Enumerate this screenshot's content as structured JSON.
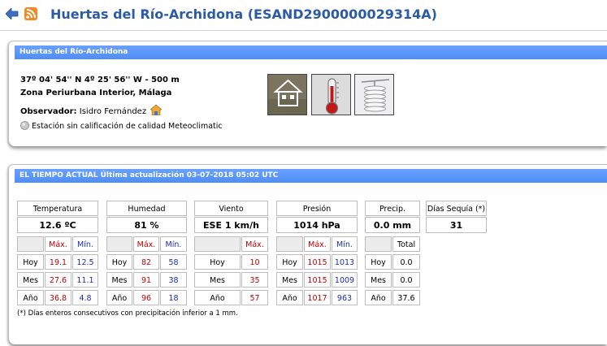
{
  "header": {
    "title": "Huertas del Río-Archidona (ESAND2900000029314A)",
    "back_icon": "back-arrow-icon",
    "rss_icon": "rss-feed-icon"
  },
  "station": {
    "panel_title": "Huertas del Río-Archidona",
    "coords": "37º 04' 54'' N   4º 25' 56'' W  -  500 m",
    "zone": "Zona Periurbana Interior, Málaga",
    "observer_label": "Observador:",
    "observer_name": "Isidro Fernández",
    "quality": "Estación sin calificación de calidad Meteoclimatic"
  },
  "weather": {
    "panel_title": "EL TIEMPO ACTUAL Última actualización 03-07-2018 05:02 UTC",
    "rows": [
      "Hoy",
      "Mes",
      "Año"
    ],
    "max_label": "Máx.",
    "min_label": "Mín.",
    "total_label": "Total",
    "temperature": {
      "label": "Temperatura",
      "current": "12.6 ºC",
      "max": [
        "19.1",
        "27.6",
        "36.8"
      ],
      "min": [
        "12.5",
        "11.1",
        "4.8"
      ]
    },
    "humidity": {
      "label": "Humedad",
      "current": "81 %",
      "max": [
        "82",
        "91",
        "96"
      ],
      "min": [
        "58",
        "38",
        "18"
      ]
    },
    "wind": {
      "label": "Viento",
      "current": "ESE  1 km/h",
      "max": [
        "10",
        "35",
        "57"
      ]
    },
    "pressure": {
      "label": "Presión",
      "current": "1014 hPa",
      "max": [
        "1015",
        "1015",
        "1017"
      ],
      "min": [
        "1013",
        "1009",
        "963"
      ]
    },
    "precip": {
      "label": "Precip.",
      "current": "0.0 mm",
      "total": [
        "0.0",
        "0.0",
        "37.6"
      ]
    },
    "dry_days": {
      "label": "Días Sequía (*)",
      "current": "31"
    },
    "footnote": "(*) Días enteros consecutivos con precipitación inferior a 1 mm."
  },
  "colors": {
    "title": "#2a5aa8",
    "panel_header": "#4f8ef7",
    "max": "#c00000",
    "min": "#1a2fb0"
  }
}
